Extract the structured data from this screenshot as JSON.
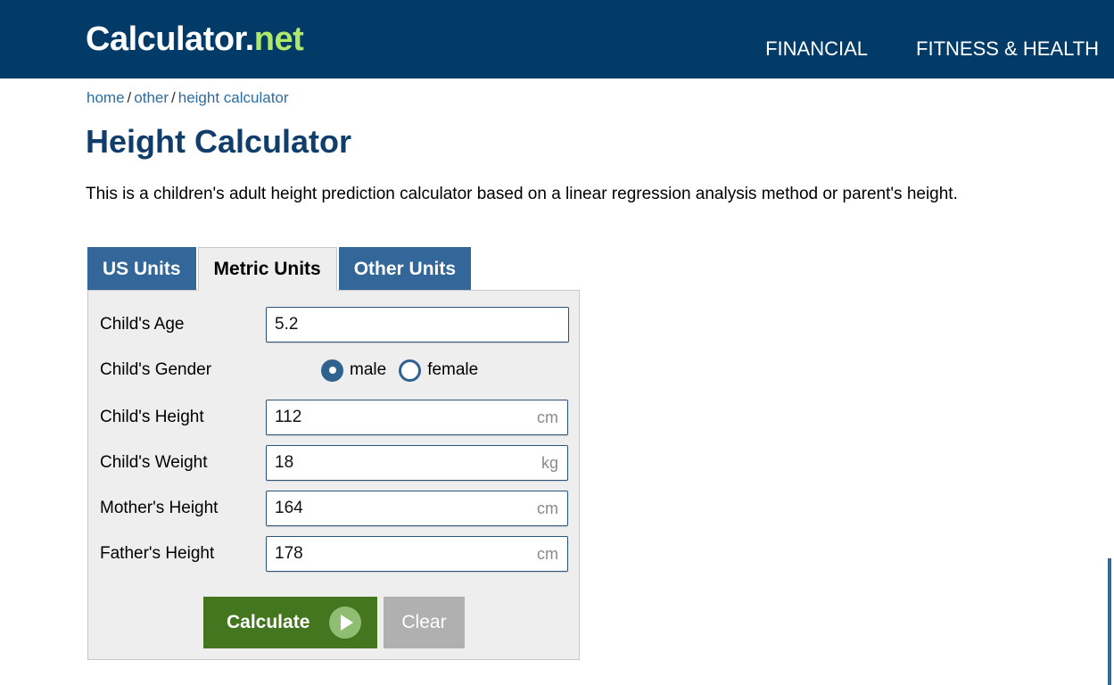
{
  "header": {
    "logo": {
      "main": "Calculator",
      "dot": ".",
      "net": "net"
    },
    "nav": [
      {
        "label": "FINANCIAL"
      },
      {
        "label": "FITNESS & HEALTH"
      }
    ],
    "background_color": "#033b68",
    "accent_color": "#b0e86a"
  },
  "breadcrumb": {
    "items": [
      {
        "label": "home"
      },
      {
        "label": "other"
      },
      {
        "label": "height calculator"
      }
    ],
    "separator": "/"
  },
  "page": {
    "title": "Height Calculator",
    "intro": "This is a children's adult height prediction calculator based on a linear regression analysis method or parent's height."
  },
  "tabs": [
    {
      "label": "US Units",
      "active": false
    },
    {
      "label": "Metric Units",
      "active": true
    },
    {
      "label": "Other Units",
      "active": false
    }
  ],
  "form": {
    "fields": [
      {
        "label": "Child's Age",
        "value": "5.2",
        "unit": ""
      },
      {
        "label": "Child's Height",
        "value": "112",
        "unit": "cm"
      },
      {
        "label": "Child's Weight",
        "value": "18",
        "unit": "kg"
      },
      {
        "label": "Mother's Height",
        "value": "164",
        "unit": "cm"
      },
      {
        "label": "Father's Height",
        "value": "178",
        "unit": "cm"
      }
    ],
    "gender": {
      "label": "Child's Gender",
      "options": [
        {
          "label": "male",
          "selected": true
        },
        {
          "label": "female",
          "selected": false
        }
      ]
    },
    "buttons": {
      "calculate": "Calculate",
      "clear": "Clear",
      "calculate_color": "#44761f",
      "clear_color": "#b0b0b0"
    }
  }
}
